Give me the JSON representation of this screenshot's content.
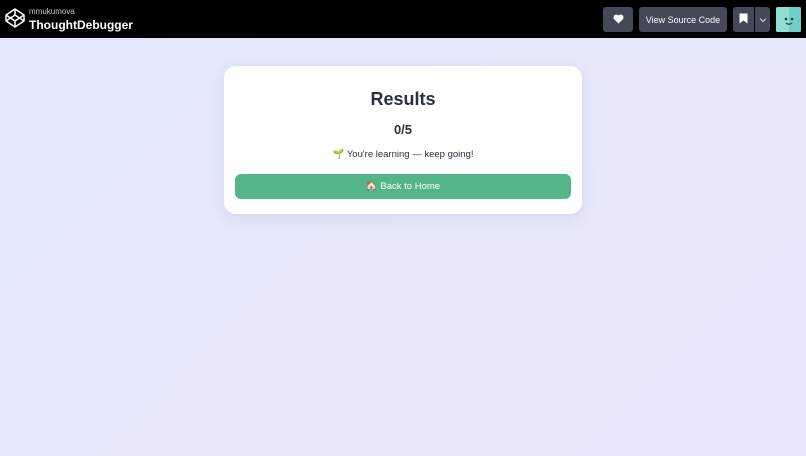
{
  "header": {
    "owner": "mmukumova",
    "pen_title": "ThoughtDebugger",
    "logo_icon": "codepen-logo-icon",
    "heart_icon": "heart-icon",
    "view_source_label": "View Source Code",
    "bookmark_icon": "bookmark-icon",
    "chevron_icon": "chevron-down-icon",
    "avatar": "user-avatar"
  },
  "results": {
    "title": "Results",
    "score": "0/5",
    "message": "🌱 You're learning — keep going!",
    "home_button_label": "🏠 Back to Home",
    "accent_color": "#54b687"
  }
}
